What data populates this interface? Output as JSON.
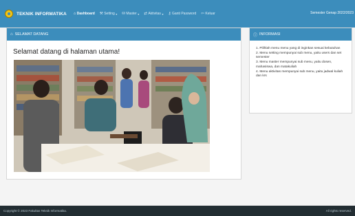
{
  "brand": {
    "title": "TEKNIK INFORMATIKA"
  },
  "nav": [
    {
      "label": "Dashboard",
      "icon": "home-icon",
      "glyph": "⌂",
      "active": true,
      "dropdown": false
    },
    {
      "label": "Setting",
      "icon": "wrench-icon",
      "glyph": "⚒",
      "active": false,
      "dropdown": true
    },
    {
      "label": "Master",
      "icon": "database-icon",
      "glyph": "⛁",
      "active": false,
      "dropdown": true
    },
    {
      "label": "Aktivitas",
      "icon": "exchange-icon",
      "glyph": "⇄",
      "active": false,
      "dropdown": true
    },
    {
      "label": "Ganti Password",
      "icon": "key-icon",
      "glyph": "⚷",
      "active": false,
      "dropdown": false
    },
    {
      "label": "Keluar",
      "icon": "sign-out-icon",
      "glyph": "⇦",
      "active": false,
      "dropdown": false
    }
  ],
  "semester": "Semester Genap 2022/2023",
  "welcome_box": {
    "title": "SELAMAT DATANG",
    "heading": "Selamat datang di halaman utama!"
  },
  "info_box": {
    "title": "INFORMASI",
    "items": [
      "1. Pilihlah menu menu yang di inginkan sesuai kebutuhan",
      "2. Menu setting mempunyai sub menu, yaitu users dan set semester",
      "3. Menu master mempunyai sub menu, yaitu dosen, mahasiswa, dan matakuliah",
      "4. Menu aktivitas mempunyai sub menu, yaitu jadwal kuliah dan krs"
    ]
  },
  "footer": {
    "copyright": "Copyright © 2023 Fakultas Teknik Informatika.",
    "rights": "All rights reserved."
  },
  "colors": {
    "primary": "#3c8dbc",
    "footer": "#222d32",
    "background": "#f4f4f4"
  }
}
